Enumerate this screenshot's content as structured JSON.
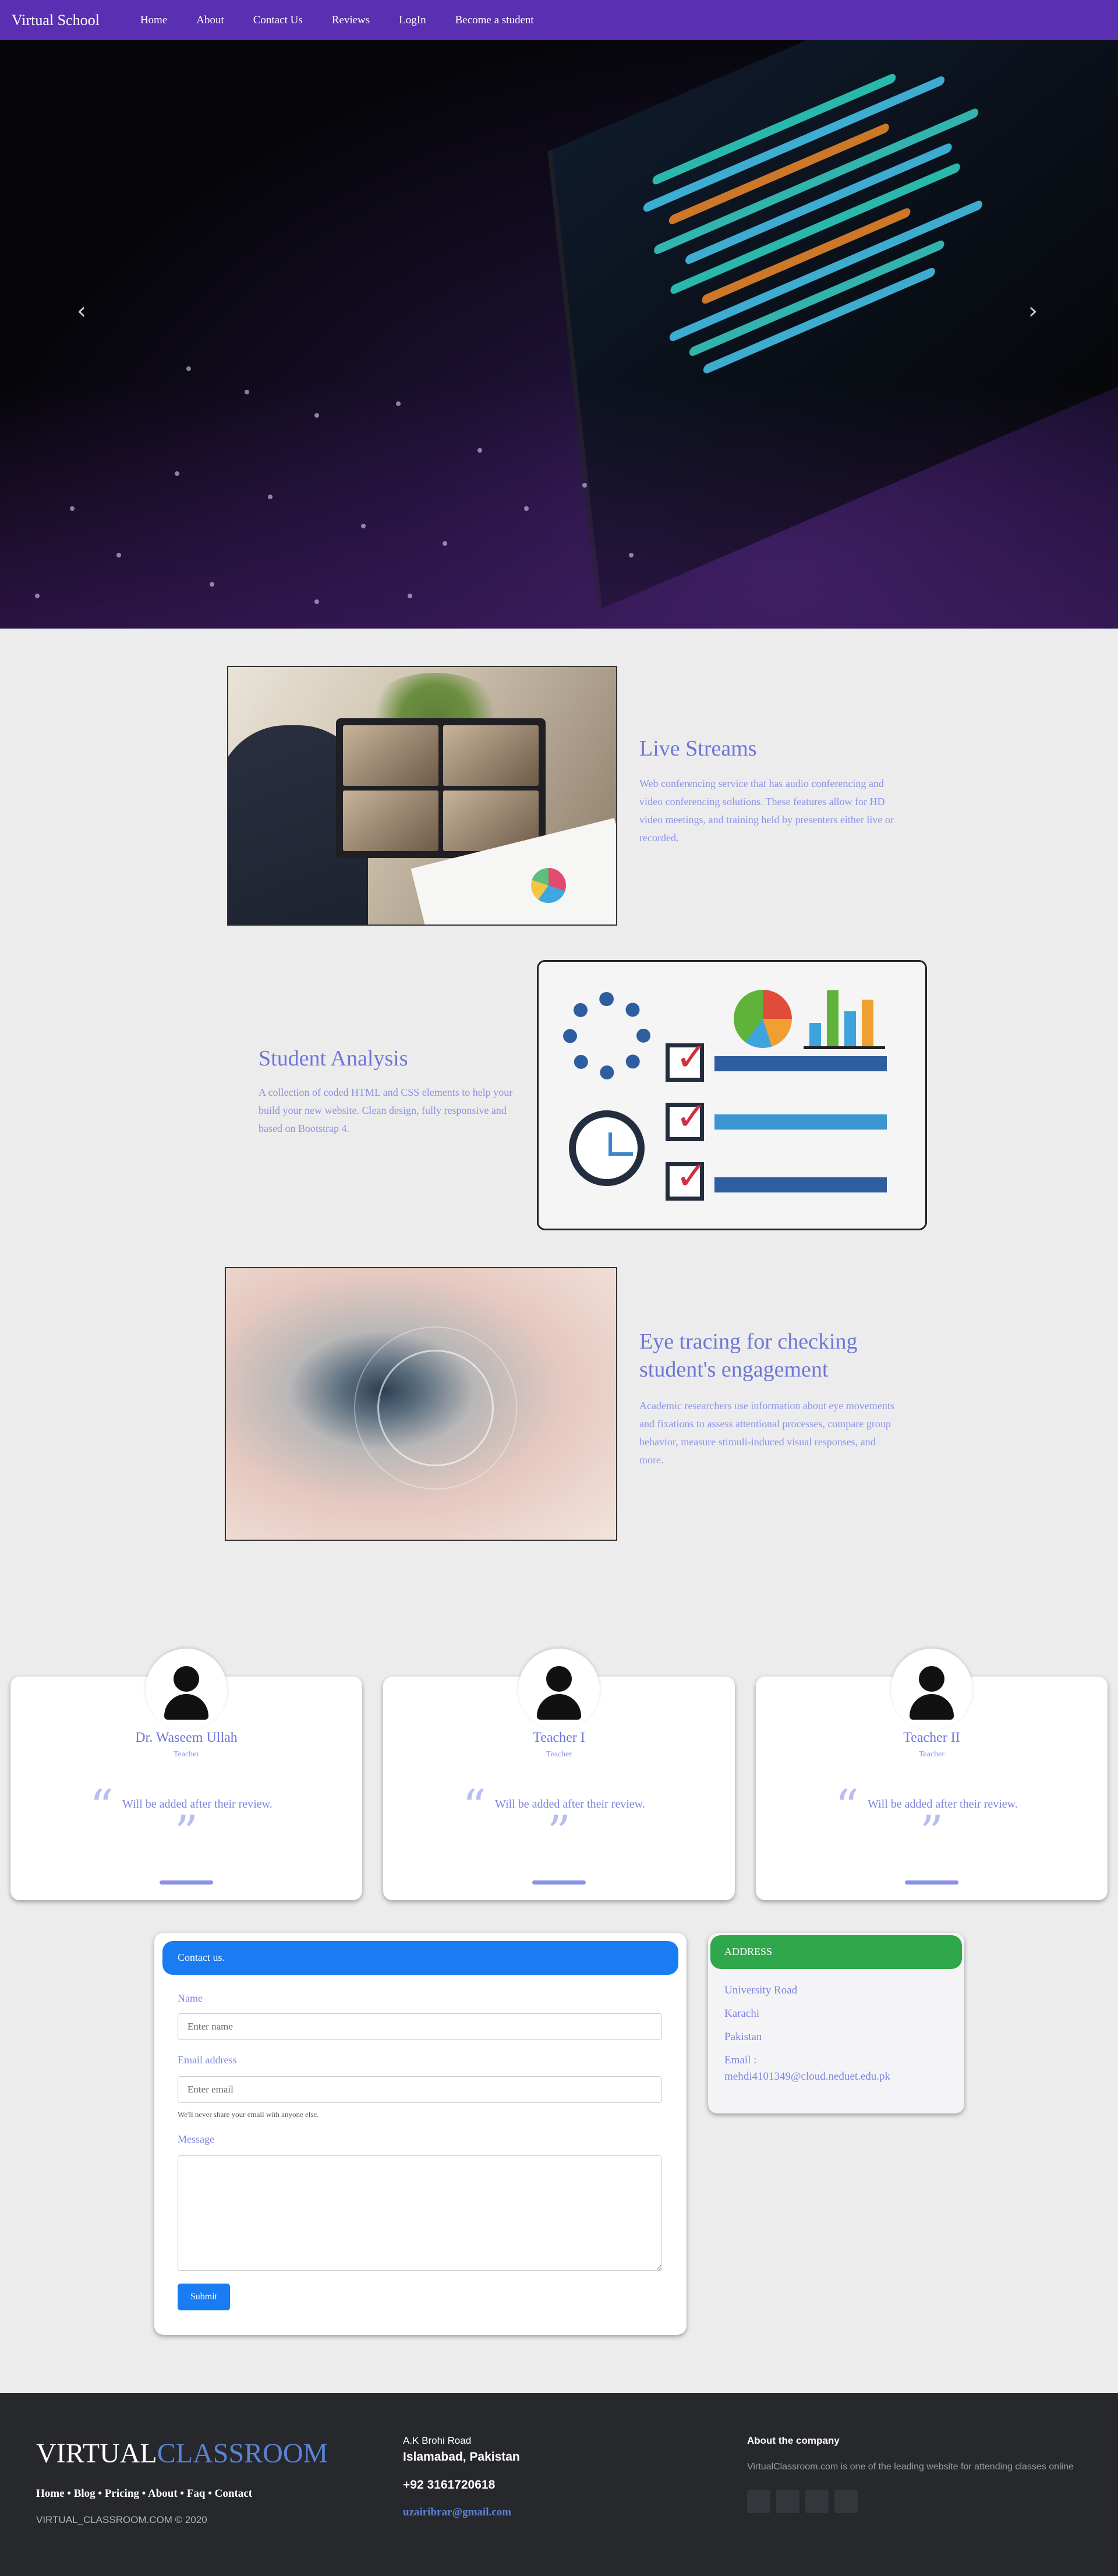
{
  "nav": {
    "brand": "Virtual School",
    "links": [
      "Home",
      "About",
      "Contact Us",
      "Reviews",
      "LogIn",
      "Become a student"
    ]
  },
  "hero": {
    "prev_icon": "chevron-left-icon",
    "next_icon": "chevron-right-icon",
    "slide_count": 3,
    "active_slide": 1
  },
  "features": [
    {
      "title": "Live Streams",
      "description": "Web conferencing service that has audio conferencing and video conferencing solutions. These features allow for HD video meetings, and training held by presenters either live or recorded."
    },
    {
      "title": "Student Analysis",
      "description": "A collection of coded HTML and CSS elements to help your build your new website. Clean design, fully responsive and based on Bootstrap 4."
    },
    {
      "title": "Eye tracing for checking student's engagement",
      "description": "Academic researchers use information about eye movements and fixations to assess attentional processes, compare group behavior, measure stimuli-induced visual responses, and more."
    }
  ],
  "team": [
    {
      "name": "Dr. Waseem Ullah",
      "role": "Teacher",
      "review": "Will be added after their review."
    },
    {
      "name": "Teacher I",
      "role": "Teacher",
      "review": "Will be added after their review."
    },
    {
      "name": "Teacher II",
      "role": "Teacher",
      "review": "Will be added after their review."
    }
  ],
  "contact": {
    "header": "Contact us.",
    "name_label": "Name",
    "name_placeholder": "Enter name",
    "email_label": "Email address",
    "email_placeholder": "Enter email",
    "email_help": "We'll never share your email with anyone else.",
    "message_label": "Message",
    "submit_label": "Submit"
  },
  "address": {
    "header": "ADDRESS",
    "lines": [
      "University Road",
      "Karachi",
      "Pakistan",
      "Email :",
      "mehdi4101349@cloud.neduet.edu.pk"
    ]
  },
  "footer": {
    "logo_main": "VIRTUAL",
    "logo_accent": "CLASSROOM",
    "nav": "Home • Blog • Pricing • About • Faq • Contact",
    "copyright": "VIRTUAL_CLASSROOM.COM © 2020",
    "address_line1": "A.K Brohi Road",
    "address_line2": "Islamabad, Pakistan",
    "phone": "+92 3161720618",
    "email": "uzairibrar@gmail.com",
    "about_title": "About the company",
    "about_text": "VirtualClassroom.com is one of the leading website for attending classes online"
  },
  "colors": {
    "nav_bg": "#5a2fb1",
    "accent_text": "#7c84e0",
    "form_header": "#1a7cf2",
    "address_header": "#2ea84a",
    "footer_bg": "#26282b"
  }
}
